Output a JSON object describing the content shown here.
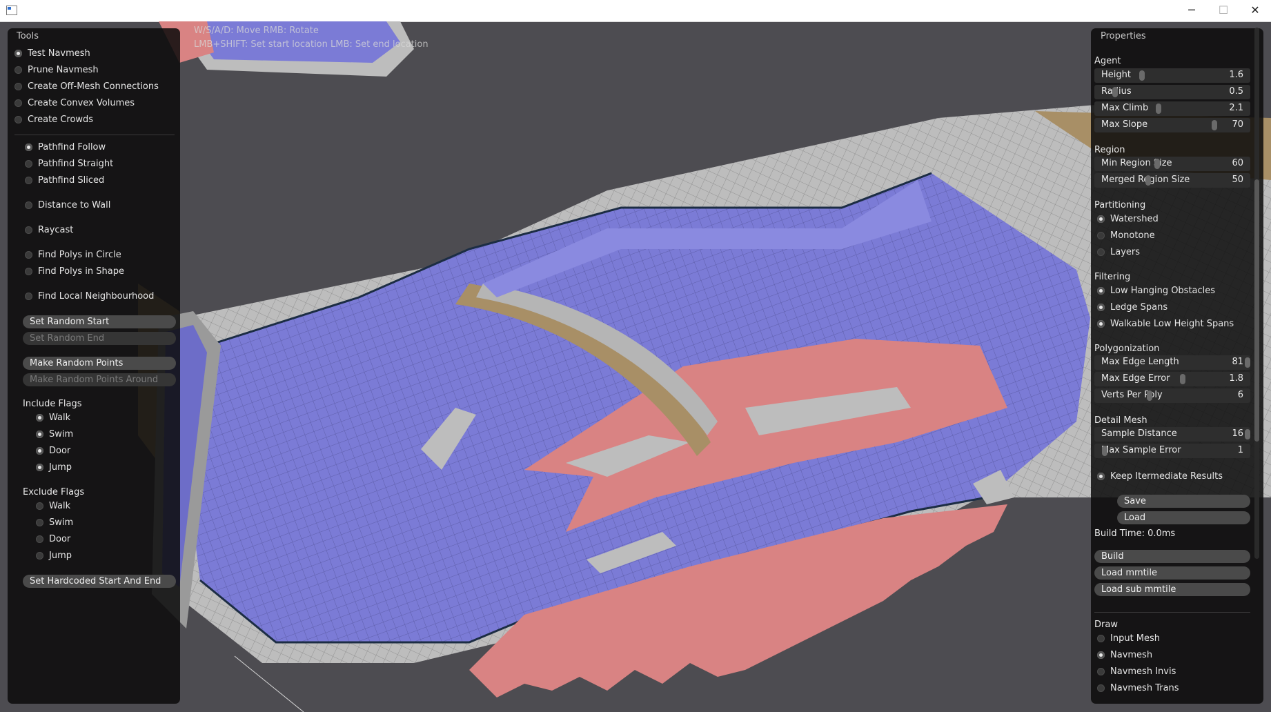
{
  "window": {
    "minimize": "─",
    "maximize": "☐",
    "close": "✕"
  },
  "hints": {
    "line1": "W/S/A/D: Move  RMB: Rotate",
    "line2": "LMB+SHIFT: Set start location  LMB: Set end location"
  },
  "tools": {
    "title": "Tools",
    "modes": [
      {
        "label": "Test Navmesh",
        "checked": true
      },
      {
        "label": "Prune Navmesh",
        "checked": false
      },
      {
        "label": "Create Off-Mesh Connections",
        "checked": false
      },
      {
        "label": "Create Convex Volumes",
        "checked": false
      },
      {
        "label": "Create Crowds",
        "checked": false
      }
    ],
    "test_options": [
      {
        "label": "Pathfind Follow",
        "checked": true
      },
      {
        "label": "Pathfind Straight",
        "checked": false
      },
      {
        "label": "Pathfind Sliced",
        "checked": false
      },
      {
        "label": "Distance to Wall",
        "checked": false
      },
      {
        "label": "Raycast",
        "checked": false
      },
      {
        "label": "Find Polys in Circle",
        "checked": false
      },
      {
        "label": "Find Polys in Shape",
        "checked": false
      },
      {
        "label": "Find Local Neighbourhood",
        "checked": false
      }
    ],
    "buttons": {
      "set_random_start": "Set Random Start",
      "set_random_end": "Set Random End",
      "make_random_points": "Make Random Points",
      "make_random_points_around": "Make Random Points Around",
      "set_hardcoded": "Set Hardcoded Start And End"
    },
    "include_flags": {
      "title": "Include Flags",
      "items": [
        {
          "label": "Walk",
          "checked": true
        },
        {
          "label": "Swim",
          "checked": true
        },
        {
          "label": "Door",
          "checked": true
        },
        {
          "label": "Jump",
          "checked": true
        }
      ]
    },
    "exclude_flags": {
      "title": "Exclude Flags",
      "items": [
        {
          "label": "Walk",
          "checked": false
        },
        {
          "label": "Swim",
          "checked": false
        },
        {
          "label": "Door",
          "checked": false
        },
        {
          "label": "Jump",
          "checked": false
        }
      ]
    }
  },
  "properties": {
    "title": "Properties",
    "agent": {
      "title": "Agent",
      "sliders": [
        {
          "label": "Height",
          "value": "1.6",
          "fraction": 0.3
        },
        {
          "label": "Radius",
          "value": "0.5",
          "fraction": 0.12
        },
        {
          "label": "Max Climb",
          "value": "2.1",
          "fraction": 0.41
        },
        {
          "label": "Max Slope",
          "value": "70",
          "fraction": 0.78
        }
      ]
    },
    "region": {
      "title": "Region",
      "sliders": [
        {
          "label": "Min Region Size",
          "value": "60",
          "fraction": 0.4
        },
        {
          "label": "Merged Region Size",
          "value": "50",
          "fraction": 0.34
        }
      ]
    },
    "partitioning": {
      "title": "Partitioning",
      "items": [
        {
          "label": "Watershed",
          "checked": true
        },
        {
          "label": "Monotone",
          "checked": false
        },
        {
          "label": "Layers",
          "checked": false
        }
      ]
    },
    "filtering": {
      "title": "Filtering",
      "items": [
        {
          "label": "Low Hanging Obstacles",
          "checked": true
        },
        {
          "label": "Ledge Spans",
          "checked": true
        },
        {
          "label": "Walkable Low Height Spans",
          "checked": true
        }
      ]
    },
    "polygonization": {
      "title": "Polygonization",
      "sliders": [
        {
          "label": "Max Edge Length",
          "value": "81",
          "fraction": 1.0
        },
        {
          "label": "Max Edge Error",
          "value": "1.8",
          "fraction": 0.57
        },
        {
          "label": "Verts Per Poly",
          "value": "6",
          "fraction": 0.35
        }
      ]
    },
    "detail_mesh": {
      "title": "Detail Mesh",
      "sliders": [
        {
          "label": "Sample Distance",
          "value": "16",
          "fraction": 1.0
        },
        {
          "label": "Max Sample Error",
          "value": "1",
          "fraction": 0.05
        }
      ],
      "keep_intermediate": {
        "label": "Keep Itermediate Results",
        "checked": true
      }
    },
    "save": "Save",
    "load": "Load",
    "build_time": "Build Time: 0.0ms",
    "build": "Build",
    "load_mmtile": "Load mmtile",
    "load_sub_mmtile": "Load sub mmtile",
    "draw": {
      "title": "Draw",
      "items": [
        {
          "label": "Input Mesh",
          "checked": false
        },
        {
          "label": "Navmesh",
          "checked": true
        },
        {
          "label": "Navmesh Invis",
          "checked": false
        },
        {
          "label": "Navmesh Trans",
          "checked": false
        }
      ]
    }
  },
  "colors": {
    "background": "#4d4c51",
    "navmesh": "#7b7bd6",
    "terrain": "#bdbdbd",
    "unwalkable": "#d98383",
    "slope": "#a88f66"
  }
}
